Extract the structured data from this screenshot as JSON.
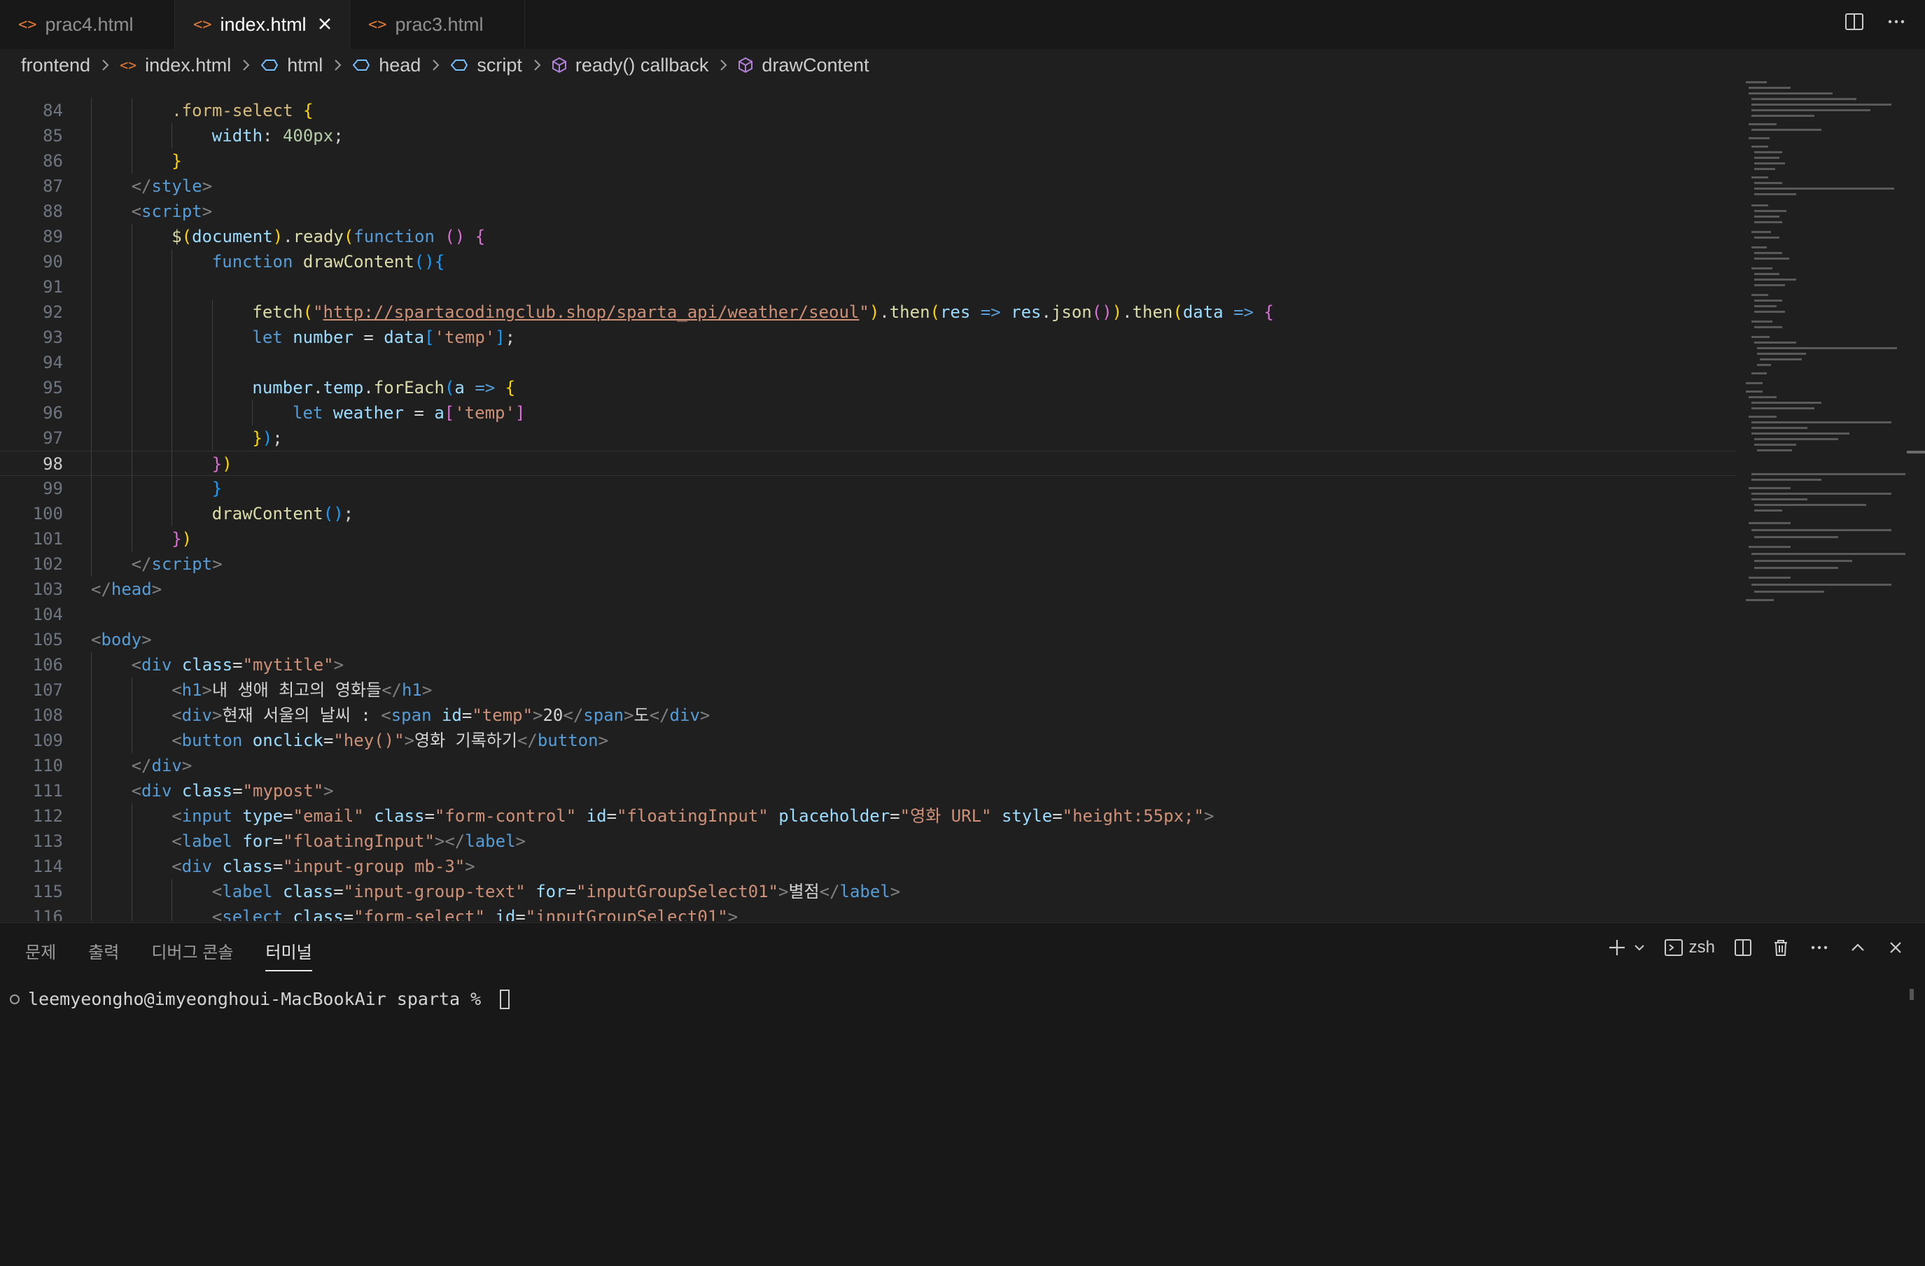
{
  "tabs": [
    {
      "label": "prac4.html",
      "active": false
    },
    {
      "label": "index.html",
      "active": true
    },
    {
      "label": "prac3.html",
      "active": false
    }
  ],
  "breadcrumb": [
    "frontend",
    "index.html",
    "html",
    "head",
    "script",
    "ready() callback",
    "drawContent"
  ],
  "editor": {
    "current_line": 98,
    "lines": [
      {
        "n": "84",
        "i": 2,
        "t": [
          [
            ".form-select",
            "sel"
          ],
          [
            " ",
            "txt"
          ],
          [
            "{",
            "br1"
          ]
        ]
      },
      {
        "n": "85",
        "i": 3,
        "t": [
          [
            "width",
            "attr"
          ],
          [
            ": ",
            "txt"
          ],
          [
            "400px",
            "num"
          ],
          [
            ";",
            "txt"
          ]
        ]
      },
      {
        "n": "86",
        "i": 2,
        "t": [
          [
            "}",
            "br1"
          ]
        ]
      },
      {
        "n": "87",
        "i": 1,
        "t": [
          [
            "</",
            "tag"
          ],
          [
            "style",
            "name"
          ],
          [
            ">",
            "tag"
          ]
        ]
      },
      {
        "n": "88",
        "i": 1,
        "t": [
          [
            "<",
            "tag"
          ],
          [
            "script",
            "name"
          ],
          [
            ">",
            "tag"
          ]
        ]
      },
      {
        "n": "89",
        "i": 2,
        "t": [
          [
            "$",
            "fn"
          ],
          [
            "(",
            "br1"
          ],
          [
            "document",
            "var"
          ],
          [
            ")",
            "br1"
          ],
          [
            ".",
            "txt"
          ],
          [
            "ready",
            "fn"
          ],
          [
            "(",
            "br1"
          ],
          [
            "function",
            "kw"
          ],
          [
            " ",
            "txt"
          ],
          [
            "()",
            "br2"
          ],
          [
            " ",
            "txt"
          ],
          [
            "{",
            "br2"
          ]
        ]
      },
      {
        "n": "90",
        "i": 3,
        "t": [
          [
            "function",
            "kw"
          ],
          [
            " ",
            "txt"
          ],
          [
            "drawContent",
            "fn"
          ],
          [
            "(){",
            "br3"
          ]
        ]
      },
      {
        "n": "91",
        "i": 3,
        "t": []
      },
      {
        "n": "92",
        "i": 4,
        "t": [
          [
            "fetch",
            "fn"
          ],
          [
            "(",
            "br1"
          ],
          [
            "\"",
            "str"
          ],
          [
            "http://spartacodingclub.shop/sparta_api/weather/seoul",
            "url"
          ],
          [
            "\"",
            "str"
          ],
          [
            ")",
            "br1"
          ],
          [
            ".",
            "txt"
          ],
          [
            "then",
            "fn"
          ],
          [
            "(",
            "br1"
          ],
          [
            "res",
            "var"
          ],
          [
            " ",
            "txt"
          ],
          [
            "=>",
            "kw"
          ],
          [
            " ",
            "txt"
          ],
          [
            "res",
            "var"
          ],
          [
            ".",
            "txt"
          ],
          [
            "json",
            "fn"
          ],
          [
            "(",
            "br2"
          ],
          [
            ")",
            "br2"
          ],
          [
            ")",
            "br1"
          ],
          [
            ".",
            "txt"
          ],
          [
            "then",
            "fn"
          ],
          [
            "(",
            "br1"
          ],
          [
            "data",
            "var"
          ],
          [
            " ",
            "txt"
          ],
          [
            "=>",
            "kw"
          ],
          [
            " ",
            "txt"
          ],
          [
            "{",
            "br2"
          ]
        ]
      },
      {
        "n": "93",
        "i": 4,
        "t": [
          [
            "let",
            "kw"
          ],
          [
            " ",
            "txt"
          ],
          [
            "number",
            "var"
          ],
          [
            " = ",
            "txt"
          ],
          [
            "data",
            "var"
          ],
          [
            "[",
            "br3"
          ],
          [
            "'temp'",
            "str"
          ],
          [
            "]",
            "br3"
          ],
          [
            ";",
            "txt"
          ]
        ]
      },
      {
        "n": "94",
        "i": 4,
        "t": []
      },
      {
        "n": "95",
        "i": 4,
        "t": [
          [
            "number",
            "var"
          ],
          [
            ".",
            "txt"
          ],
          [
            "temp",
            "var"
          ],
          [
            ".",
            "txt"
          ],
          [
            "forEach",
            "fn"
          ],
          [
            "(",
            "br3"
          ],
          [
            "a",
            "var"
          ],
          [
            " ",
            "txt"
          ],
          [
            "=>",
            "kw"
          ],
          [
            " ",
            "txt"
          ],
          [
            "{",
            "br1"
          ]
        ]
      },
      {
        "n": "96",
        "i": 5,
        "t": [
          [
            "let",
            "kw"
          ],
          [
            " ",
            "txt"
          ],
          [
            "weather",
            "var"
          ],
          [
            " = ",
            "txt"
          ],
          [
            "a",
            "var"
          ],
          [
            "[",
            "br2"
          ],
          [
            "'temp'",
            "str"
          ],
          [
            "]",
            "br2"
          ]
        ]
      },
      {
        "n": "97",
        "i": 4,
        "t": [
          [
            "}",
            "br1"
          ],
          [
            ")",
            "br3"
          ],
          [
            ";",
            "txt"
          ]
        ]
      },
      {
        "n": "98",
        "i": 3,
        "t": [
          [
            "}",
            "br2"
          ],
          [
            ")",
            "br1"
          ]
        ]
      },
      {
        "n": "99",
        "i": 3,
        "t": [
          [
            "}",
            "br3"
          ]
        ]
      },
      {
        "n": "100",
        "i": 3,
        "t": [
          [
            "drawContent",
            "fn"
          ],
          [
            "()",
            "br3"
          ],
          [
            ";",
            "txt"
          ]
        ]
      },
      {
        "n": "101",
        "i": 2,
        "t": [
          [
            "}",
            "br2"
          ],
          [
            ")",
            "br1"
          ]
        ]
      },
      {
        "n": "102",
        "i": 1,
        "t": [
          [
            "</",
            "tag"
          ],
          [
            "script",
            "name"
          ],
          [
            ">",
            "tag"
          ]
        ]
      },
      {
        "n": "103",
        "i": 0,
        "t": [
          [
            "</",
            "tag"
          ],
          [
            "head",
            "name"
          ],
          [
            ">",
            "tag"
          ]
        ]
      },
      {
        "n": "104",
        "i": 0,
        "t": []
      },
      {
        "n": "105",
        "i": 0,
        "t": [
          [
            "<",
            "tag"
          ],
          [
            "body",
            "name"
          ],
          [
            ">",
            "tag"
          ]
        ]
      },
      {
        "n": "106",
        "i": 1,
        "t": [
          [
            "<",
            "tag"
          ],
          [
            "div",
            "name"
          ],
          [
            " ",
            "txt"
          ],
          [
            "class",
            "attr"
          ],
          [
            "=",
            "txt"
          ],
          [
            "\"mytitle\"",
            "str"
          ],
          [
            ">",
            "tag"
          ]
        ]
      },
      {
        "n": "107",
        "i": 2,
        "t": [
          [
            "<",
            "tag"
          ],
          [
            "h1",
            "name"
          ],
          [
            ">",
            "tag"
          ],
          [
            "내 생애 최고의 영화들",
            "txt"
          ],
          [
            "</",
            "tag"
          ],
          [
            "h1",
            "name"
          ],
          [
            ">",
            "tag"
          ]
        ]
      },
      {
        "n": "108",
        "i": 2,
        "t": [
          [
            "<",
            "tag"
          ],
          [
            "div",
            "name"
          ],
          [
            ">",
            "tag"
          ],
          [
            "현재 서울의 날씨 : ",
            "txt"
          ],
          [
            "<",
            "tag"
          ],
          [
            "span",
            "name"
          ],
          [
            " ",
            "txt"
          ],
          [
            "id",
            "attr"
          ],
          [
            "=",
            "txt"
          ],
          [
            "\"temp\"",
            "str"
          ],
          [
            ">",
            "tag"
          ],
          [
            "20",
            "txt"
          ],
          [
            "</",
            "tag"
          ],
          [
            "span",
            "name"
          ],
          [
            ">",
            "tag"
          ],
          [
            "도",
            "txt"
          ],
          [
            "</",
            "tag"
          ],
          [
            "div",
            "name"
          ],
          [
            ">",
            "tag"
          ]
        ]
      },
      {
        "n": "109",
        "i": 2,
        "t": [
          [
            "<",
            "tag"
          ],
          [
            "button",
            "name"
          ],
          [
            " ",
            "txt"
          ],
          [
            "onclick",
            "attr"
          ],
          [
            "=",
            "txt"
          ],
          [
            "\"hey()\"",
            "str"
          ],
          [
            ">",
            "tag"
          ],
          [
            "영화 기록하기",
            "txt"
          ],
          [
            "</",
            "tag"
          ],
          [
            "button",
            "name"
          ],
          [
            ">",
            "tag"
          ]
        ]
      },
      {
        "n": "110",
        "i": 1,
        "t": [
          [
            "</",
            "tag"
          ],
          [
            "div",
            "name"
          ],
          [
            ">",
            "tag"
          ]
        ]
      },
      {
        "n": "111",
        "i": 1,
        "t": [
          [
            "<",
            "tag"
          ],
          [
            "div",
            "name"
          ],
          [
            " ",
            "txt"
          ],
          [
            "class",
            "attr"
          ],
          [
            "=",
            "txt"
          ],
          [
            "\"mypost\"",
            "str"
          ],
          [
            ">",
            "tag"
          ]
        ]
      },
      {
        "n": "112",
        "i": 2,
        "t": [
          [
            "<",
            "tag"
          ],
          [
            "input",
            "name"
          ],
          [
            " ",
            "txt"
          ],
          [
            "type",
            "attr"
          ],
          [
            "=",
            "txt"
          ],
          [
            "\"email\"",
            "str"
          ],
          [
            " ",
            "txt"
          ],
          [
            "class",
            "attr"
          ],
          [
            "=",
            "txt"
          ],
          [
            "\"form-control\"",
            "str"
          ],
          [
            " ",
            "txt"
          ],
          [
            "id",
            "attr"
          ],
          [
            "=",
            "txt"
          ],
          [
            "\"floatingInput\"",
            "str"
          ],
          [
            " ",
            "txt"
          ],
          [
            "placeholder",
            "attr"
          ],
          [
            "=",
            "txt"
          ],
          [
            "\"영화 URL\"",
            "str"
          ],
          [
            " ",
            "txt"
          ],
          [
            "style",
            "attr"
          ],
          [
            "=",
            "txt"
          ],
          [
            "\"height:55px;\"",
            "str"
          ],
          [
            ">",
            "tag"
          ]
        ]
      },
      {
        "n": "113",
        "i": 2,
        "t": [
          [
            "<",
            "tag"
          ],
          [
            "label",
            "name"
          ],
          [
            " ",
            "txt"
          ],
          [
            "for",
            "attr"
          ],
          [
            "=",
            "txt"
          ],
          [
            "\"floatingInput\"",
            "str"
          ],
          [
            "></",
            "tag"
          ],
          [
            "label",
            "name"
          ],
          [
            ">",
            "tag"
          ]
        ]
      },
      {
        "n": "114",
        "i": 2,
        "t": [
          [
            "<",
            "tag"
          ],
          [
            "div",
            "name"
          ],
          [
            " ",
            "txt"
          ],
          [
            "class",
            "attr"
          ],
          [
            "=",
            "txt"
          ],
          [
            "\"input-group mb-3\"",
            "str"
          ],
          [
            ">",
            "tag"
          ]
        ]
      },
      {
        "n": "115",
        "i": 3,
        "t": [
          [
            "<",
            "tag"
          ],
          [
            "label",
            "name"
          ],
          [
            " ",
            "txt"
          ],
          [
            "class",
            "attr"
          ],
          [
            "=",
            "txt"
          ],
          [
            "\"input-group-text\"",
            "str"
          ],
          [
            " ",
            "txt"
          ],
          [
            "for",
            "attr"
          ],
          [
            "=",
            "txt"
          ],
          [
            "\"inputGroupSelect01\"",
            "str"
          ],
          [
            ">",
            "tag"
          ],
          [
            "별점",
            "txt"
          ],
          [
            "</",
            "tag"
          ],
          [
            "label",
            "name"
          ],
          [
            ">",
            "tag"
          ]
        ]
      },
      {
        "n": "116",
        "i": 3,
        "t": [
          [
            "<",
            "tag"
          ],
          [
            "select",
            "name"
          ],
          [
            " ",
            "txt"
          ],
          [
            "class",
            "attr"
          ],
          [
            "=",
            "txt"
          ],
          [
            "\"form-select\"",
            "str"
          ],
          [
            " ",
            "txt"
          ],
          [
            "id",
            "attr"
          ],
          [
            "=",
            "txt"
          ],
          [
            "\"inputGroupSelect01\"",
            "str"
          ],
          [
            ">",
            "tag"
          ]
        ]
      }
    ]
  },
  "panel": {
    "tabs": [
      {
        "label": "문제",
        "active": false
      },
      {
        "label": "출력",
        "active": false
      },
      {
        "label": "디버그 콘솔",
        "active": false
      },
      {
        "label": "터미널",
        "active": true
      }
    ],
    "shell_label": "zsh",
    "terminal_prompt": "leemyeongho@imyeonghoui-MacBookAir sparta % "
  }
}
